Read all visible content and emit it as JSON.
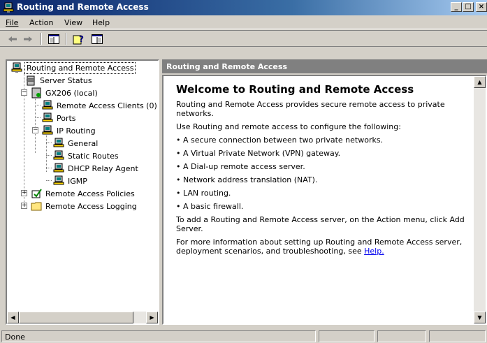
{
  "window": {
    "title": "Routing and Remote Access",
    "minimize": "_",
    "maximize": "□",
    "close": "×"
  },
  "menu": [
    "File",
    "Action",
    "View",
    "Help"
  ],
  "tree": {
    "root": "Routing and Remote Access",
    "server_status": "Server Status",
    "server": "GX206 (local)",
    "remote_clients": "Remote Access Clients (0)",
    "ports": "Ports",
    "ip_routing": "IP Routing",
    "general": "General",
    "static_routes": "Static Routes",
    "dhcp_relay": "DHCP Relay Agent",
    "igmp": "IGMP",
    "policies": "Remote Access Policies",
    "logging": "Remote Access Logging"
  },
  "right": {
    "header": "Routing and Remote Access",
    "heading": "Welcome to Routing and Remote Access",
    "intro": "Routing and Remote Access provides secure remote access to private networks.",
    "use": "Use Routing and remote access to configure the following:",
    "bullets": [
      "• A secure connection between two private networks.",
      "• A Virtual Private Network (VPN) gateway.",
      "• A Dial-up remote access server.",
      "• Network address translation (NAT).",
      "• LAN routing.",
      "• A basic firewall."
    ],
    "add_server": "To add a Routing and Remote Access server, on the Action menu, click Add Server.",
    "more_info": "For more information about setting up Routing and Remote Access server, deployment scenarios, and troubleshooting, see",
    "help_link": "Help."
  },
  "status": {
    "text": "Done"
  }
}
